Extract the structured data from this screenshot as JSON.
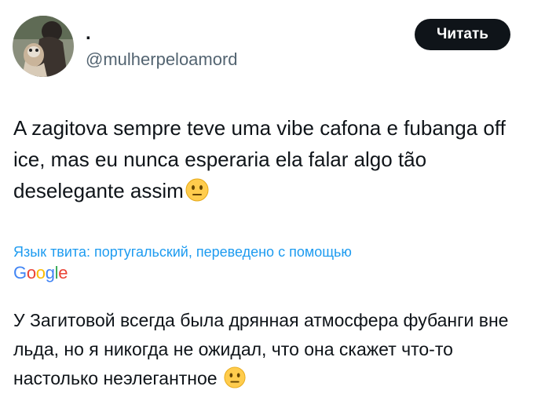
{
  "author": {
    "display_name": ".",
    "handle": "@mulherpeloamord"
  },
  "follow_button": {
    "label": "Читать"
  },
  "tweet": {
    "text": "A zagitova sempre teve uma vibe cafona e fubanga off ice, mas eu nunca esperaria ela falar algo tão deselegante assim",
    "emoji": "neutral-face"
  },
  "translation": {
    "note": "Язык твита: португальский, переведено с помощью",
    "provider_letters": [
      "G",
      "o",
      "o",
      "g",
      "l",
      "e"
    ],
    "text": "У Загитовой всегда была дрянная атмосфера фубанги вне льда, но я никогда не ожидал, что она скажет что-то настолько неэлегантное",
    "emoji": "neutral-face"
  },
  "colors": {
    "text_primary": "#0f1419",
    "text_secondary": "#536471",
    "link_blue": "#1d9bf0",
    "button_bg": "#0f1419",
    "google_blue": "#4285f4",
    "google_red": "#ea4335",
    "google_yellow": "#fbbc05",
    "google_green": "#34a853"
  }
}
